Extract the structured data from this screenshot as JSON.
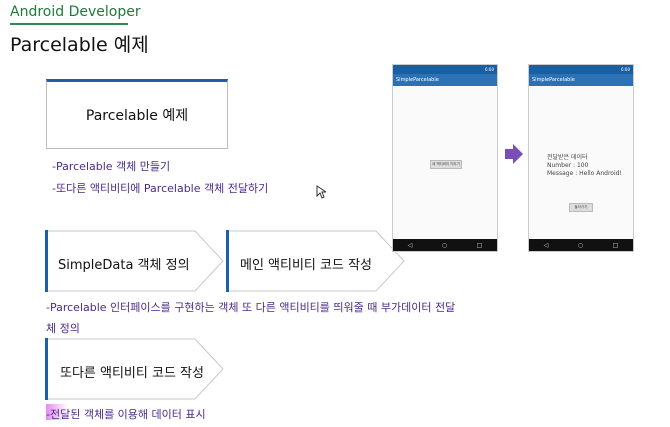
{
  "header": {
    "brand": "Android Developer",
    "page_title": "Parcelable 예제"
  },
  "title_box": {
    "label": "Parcelable 예제"
  },
  "notes": {
    "note1": "-Parcelable 객체 만들기",
    "note2": "-또다른 액티비티에 Parcelable 객체 전달하기",
    "note3": "-Parcelable 인터페이스를 구현하는 객체 또 다른 액티비티를 띄워줄 때 부가데이터 전달",
    "note4": "체 정의",
    "note5": "-전달된 객체를 이용해 데이터 표시"
  },
  "steps": {
    "step1": "SimpleData 객체 정의",
    "step2": "메인 액티비티 코드 작성",
    "step3": "또다른 액티비티 코드 작성"
  },
  "phone1": {
    "status": "6:00",
    "app_title": "SimpleParcelable",
    "button": "새 액티비티 띄우기"
  },
  "phone2": {
    "status": "6:00",
    "app_title": "SimpleParcelable",
    "line1": "전달받은 데이터",
    "line2": "Number : 100",
    "line3": "Message : Hello Android!",
    "button": "돌아가기"
  },
  "nav": {
    "back": "◁",
    "home": "○",
    "recent": "□"
  },
  "colors": {
    "brand_green": "#1e7a3a",
    "accent_blue": "#1f5fa8",
    "note_purple": "#4b2a8a",
    "arrow_purple": "#7a4fb5"
  }
}
